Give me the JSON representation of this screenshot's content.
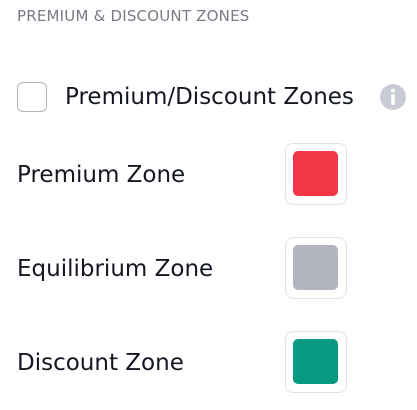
{
  "section": {
    "title": "PREMIUM & DISCOUNT ZONES"
  },
  "toggle": {
    "label": "Premium/Discount Zones",
    "checked": false,
    "info_icon": "info-icon"
  },
  "zones": [
    {
      "label": "Premium Zone",
      "color": "#f23645"
    },
    {
      "label": "Equilibrium Zone",
      "color": "#b2b5be"
    },
    {
      "label": "Discount Zone",
      "color": "#089981"
    }
  ],
  "colors": {
    "text": "#131722",
    "muted": "#787b86",
    "border": "#e0e3eb",
    "info_icon": "#c9ccd4"
  }
}
